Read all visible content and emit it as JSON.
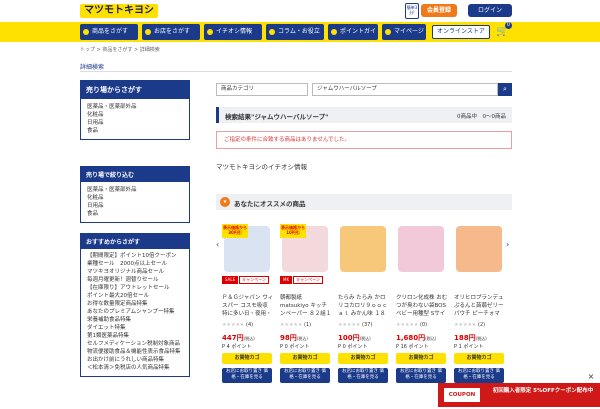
{
  "header": {
    "logo": "マツモトキヨシ",
    "simple_badge": "簡単3分!",
    "register": "会員登録",
    "login": "ログイン"
  },
  "nav": {
    "items": [
      "商品をさがす",
      "お店をさがす",
      "イチオシ情報",
      "コラム・お役立ち",
      "ポイントガイド",
      "マイページ"
    ],
    "online": "オンラインストア",
    "cart_count": "0"
  },
  "breadcrumb": "トップ > 商品をさがす > 詳細検索",
  "page_title": "詳細検索",
  "sidebar": {
    "section1": {
      "title": "売り場からさがす",
      "items": [
        "医薬品・医薬部外品",
        "化粧品",
        "日用品",
        "食品"
      ]
    },
    "section2": {
      "title": "売り場で絞り込む",
      "items": [
        "医薬品・医薬部外品",
        "化粧品",
        "日用品",
        "食品"
      ]
    },
    "section3": {
      "title": "おすすめからさがす",
      "items": [
        "【期間限定】ポイント10倍クーポン",
        "業種セール　2000点以上セール",
        "マツキヨオリジナル商品セール",
        "毎週月曜更新！週替りセール",
        "【在庫限り】アウトレットセール",
        "ポイント最大20倍セール",
        "お得な数量限定商品特集",
        "あなたのプレミアムシャンプー特集",
        "栄養補助食品特集",
        "ダイエット特集",
        "第1類医薬品特集",
        "セルフメディケーション税制対象商品",
        "物流便援助食品＆機能性表示食品特集",
        "お出かけ前にうれしい商品特集",
        "＜松本清＞免税店の人気商品特集"
      ]
    }
  },
  "search": {
    "category": "商品カテゴリ",
    "keyword": "ジャムウハーバルソープ"
  },
  "results": {
    "title": "検索結果\"ジャムウハーバルソープ\"",
    "count": "0商品中　0〜0商品",
    "error": "ご指定の条件に合致する商品はありませんでした。"
  },
  "pickup_title": "マツモトキヨシのイチオシ情報",
  "recommend_title": "あなたにオススメの商品",
  "products": [
    {
      "ribbon": "表示価格から 30円引",
      "tags": [
        "SALE",
        "キャンペーン"
      ],
      "name": "Ｐ＆Ｇジャパン ウィスパー コスモ吸収 特に多い日・夜用・羽",
      "stars": "★★★★★",
      "reviews": "(4)",
      "price": "447円",
      "price_note": "(税込)",
      "points": "P 4 ポイント",
      "buy": "お買物カゴ",
      "stock": "お店にお取り置き 価格・在庫を見る",
      "color": "#d9e3f2"
    },
    {
      "ribbon": "表示価格から 10円引",
      "tags": [
        "MK",
        "キャンペーン"
      ],
      "name": "朝都製紙 matsukiyo キッチンペーパー ８２組１６４枚",
      "stars": "★★★★★",
      "reviews": "(1)",
      "price": "98円",
      "price_note": "(税込)",
      "points": "P 0 ポイント",
      "buy": "お買物カゴ",
      "stock": "お店にお取り置き 価格・在庫を見る",
      "color": "#f3d9dc"
    },
    {
      "ribbon": "",
      "tags": [],
      "name": "たらみ たらみ かロリコカロリ９ｏｏｃａｌ みかん味 １８",
      "stars": "★★★★★",
      "reviews": "(37)",
      "price": "100円",
      "price_note": "(税込)",
      "points": "P 0 ポイント",
      "buy": "お買物カゴ",
      "stock": "お店にお取り置き 価格・在庫を見る",
      "color": "#f7c77a"
    },
    {
      "ribbon": "",
      "tags": [],
      "name": "クリロン化成株 おむつが臭わない袋BOS ベビー用種型 Sサイ",
      "stars": "★★★★★",
      "reviews": "(0)",
      "price": "1,680円",
      "price_note": "(税込)",
      "points": "P 16 ポイント",
      "buy": "お買物カゴ",
      "stock": "お店にお取り置き 価格・在庫を見る",
      "color": "#f2c9d9"
    },
    {
      "ribbon": "",
      "tags": [],
      "name": "オリヒロプランデュ ぷるんと蒟蒻ゼリーパウチ ピーチォマ",
      "stars": "★★★★★",
      "reviews": "(2)",
      "price": "188円",
      "price_note": "(税込)",
      "points": "P 1 ポイント",
      "buy": "お買物カゴ",
      "stock": "お店にお取り置き 価格・在庫を見る",
      "color": "#f6b98c"
    }
  ],
  "coupon": {
    "label": "COUPON",
    "text": "初回購入者限定 5%OFFクーポン配布中"
  }
}
